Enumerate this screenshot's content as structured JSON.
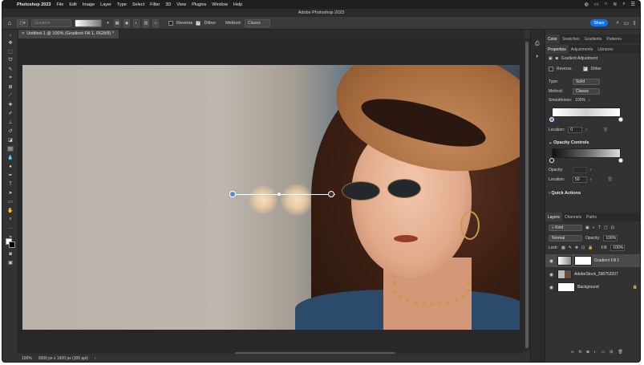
{
  "menubar": {
    "app": "Photoshop 2023",
    "items": [
      "File",
      "Edit",
      "Image",
      "Layer",
      "Type",
      "Select",
      "Filter",
      "3D",
      "View",
      "Plugins",
      "Window",
      "Help"
    ]
  },
  "window_title": "Adobe Photoshop 2023",
  "options_bar": {
    "gradient_label": "Gradient",
    "reverse_label": "Reverse",
    "dither_label": "Dither",
    "method_label": "Method:",
    "method_value": "Classic",
    "share_label": "Share"
  },
  "document_tab": "Untitled-1 @ 100% (Gradient Fill 1, RGB/8) *",
  "status": {
    "zoom": "100%",
    "doc_info": "3000 px x 1600 px (300 ppi)"
  },
  "top_panel": {
    "tabs": [
      "Color",
      "Swatches",
      "Gradients",
      "Patterns"
    ],
    "active": "Color"
  },
  "properties": {
    "tabs": [
      "Properties",
      "Adjustments",
      "Libraries"
    ],
    "header": "Gradient Adjustment",
    "reverse_label": "Reverse",
    "dither_label": "Dither",
    "dither_checked": true,
    "type_label": "Type:",
    "type_value": "Solid",
    "method_label": "Method:",
    "method_value": "Classic",
    "smoothness_label": "Smoothness:",
    "smoothness_value": "100%",
    "location_label": "Location:",
    "location_value": "0",
    "opacity_section": "Opacity Controls",
    "opacity_label": "Opacity:",
    "opacity_location_label": "Location:",
    "opacity_location_value": "50",
    "quick_actions": "Quick Actions"
  },
  "layers_panel": {
    "tabs": [
      "Layers",
      "Channels",
      "Paths"
    ],
    "filter_kind": "Kind",
    "blend_mode": "Normal",
    "opacity_label": "Opacity:",
    "opacity_value": "100%",
    "lock_label": "Lock:",
    "fill_label": "Fill:",
    "fill_value": "100%",
    "layers": [
      {
        "name": "Gradient Fill 1"
      },
      {
        "name": "AdobeStock_298753207"
      },
      {
        "name": "Background"
      }
    ]
  },
  "colors": {
    "accent": "#1473e6",
    "ui_bg": "#323232"
  }
}
